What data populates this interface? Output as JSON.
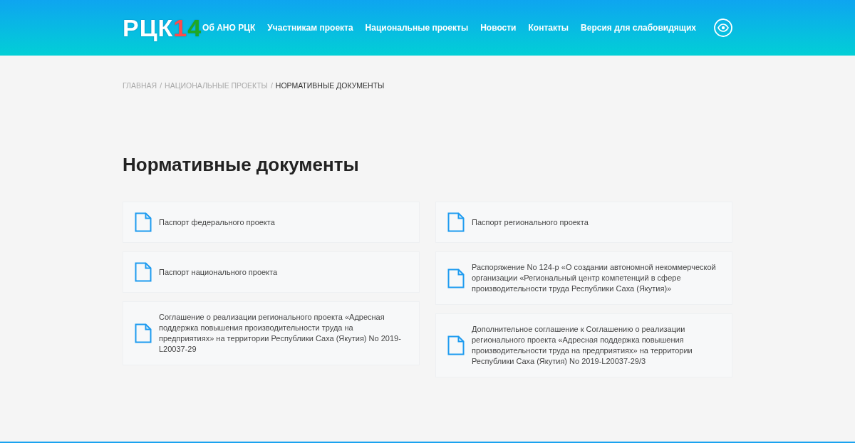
{
  "header": {
    "logo": [
      {
        "text": "РЦК",
        "color": "#ffffff"
      },
      {
        "text": "1",
        "color": "#ff4b4b"
      },
      {
        "text": "4",
        "color": "#1fa824"
      }
    ],
    "nav": [
      "Об АНО РЦК",
      "Участникам проекта",
      "Национальные проекты",
      "Новости",
      "Контакты",
      "Версия для слабовидящих"
    ]
  },
  "breadcrumb_separator": "/",
  "breadcrumbs": [
    {
      "label": "ГЛАВНАЯ",
      "current": false
    },
    {
      "label": "НАЦИОНАЛЬНЫЕ ПРОЕКТЫ",
      "current": false
    },
    {
      "label": "НОРМАТИВНЫЕ ДОКУМЕНТЫ",
      "current": true
    }
  ],
  "title": "Нормативные документы",
  "columns": [
    {
      "documents": [
        {
          "title": "Паспорт федерального проекта"
        },
        {
          "title": "Паспорт национального проекта"
        },
        {
          "title": "Соглашение о реализации регионального проекта «Адресная поддержка повышения производительности труда на предприятиях» на территории Республики Саха (Якутия) No 2019-L20037-29"
        }
      ]
    },
    {
      "documents": [
        {
          "title": "Паспорт регионального проекта"
        },
        {
          "title": "Распоряжение No 124-р «О создании автономной некоммерческой организации «Региональный центр компетенций в сфере производительности труда Республики Саха (Якутия)»"
        },
        {
          "title": "Дополнительное соглашение к Соглашению о реализации регионального проекта «Адресная поддержка повышения производительности труда на предприятиях» на территории Республики Саха (Якутия) No 2019-L20037-29/3"
        }
      ]
    }
  ]
}
